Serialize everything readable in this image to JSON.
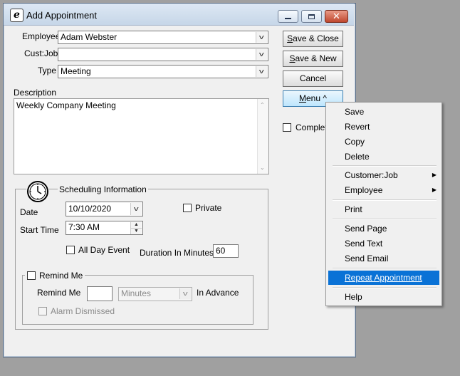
{
  "window": {
    "title": "Add Appointment",
    "close_glyph": "✕"
  },
  "form": {
    "employee_label": "Employee",
    "employee_value": "Adam Webster",
    "custjob_label": "Cust:Job",
    "custjob_value": "",
    "type_label": "Type",
    "type_value": "Meeting",
    "description_label": "Description",
    "description_value": "Weekly Company Meeting"
  },
  "buttons": {
    "save_close_pre": "S",
    "save_close_rest": "ave & Close",
    "save_new_pre": "S",
    "save_new_rest": "ave & New",
    "cancel": "Cancel",
    "menu_pre": "M",
    "menu_rest": "enu ^"
  },
  "completed_label": "Complete",
  "scheduling": {
    "header": "Scheduling Information",
    "date_label": "Date",
    "date_value": "10/10/2020",
    "private_label": "Private",
    "start_time_label": "Start Time",
    "start_time_value": "7:30 AM",
    "all_day_label": "All Day Event",
    "duration_label": "Duration In Minutes",
    "duration_value": "60"
  },
  "remind": {
    "header": "Remind Me",
    "remind_label": "Remind Me",
    "remind_value": "",
    "unit_value": "Minutes",
    "in_advance_label": "In Advance",
    "alarm_dismissed_label": "Alarm Dismissed"
  },
  "menu": {
    "items": [
      "Save",
      "Revert",
      "Copy",
      "Delete",
      "Customer:Job",
      "Employee",
      "Print",
      "Send Page",
      "Send Text",
      "Send Email",
      "Repeat Appointment",
      "Help"
    ],
    "submenu_arrow": "▶"
  },
  "colors": {
    "highlight": "#0a72d6",
    "background": "#a0a0a0"
  },
  "icons": {
    "app": "e-logo-icon",
    "clock": "clock-icon"
  }
}
